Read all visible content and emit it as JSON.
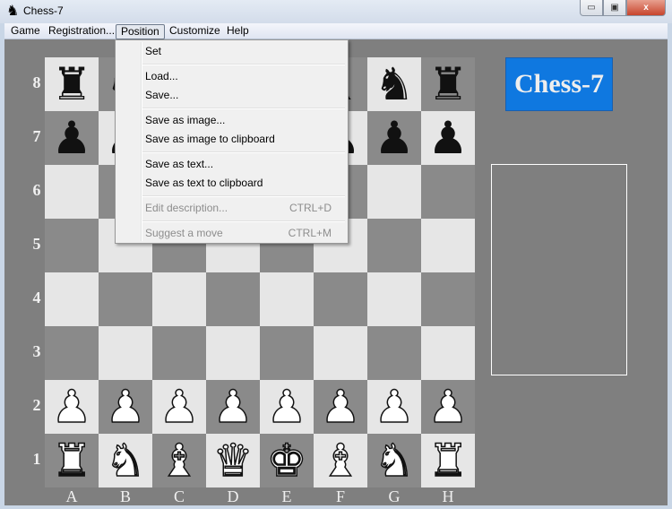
{
  "window": {
    "title": "Chess-7",
    "icon": "♞",
    "minimize": "▭",
    "maximize": "▣",
    "close": "x"
  },
  "menu": [
    "Game",
    "Registration...",
    "Position",
    "Customize",
    "Help"
  ],
  "position_menu": {
    "items": [
      {
        "label": "Set",
        "shortcut": "",
        "enabled": true
      },
      {
        "label": "Load...",
        "shortcut": "",
        "enabled": true
      },
      {
        "label": "Save...",
        "shortcut": "",
        "enabled": true
      },
      {
        "label": "Save as image...",
        "shortcut": "",
        "enabled": true
      },
      {
        "label": "Save as image to clipboard",
        "shortcut": "",
        "enabled": true
      },
      {
        "label": "Save as text...",
        "shortcut": "",
        "enabled": true
      },
      {
        "label": "Save as text to clipboard",
        "shortcut": "",
        "enabled": true
      },
      {
        "label": "Edit description...",
        "shortcut": "CTRL+D",
        "enabled": false
      },
      {
        "label": "Suggest a move",
        "shortcut": "CTRL+M",
        "enabled": false
      }
    ]
  },
  "board": {
    "ranks": [
      "8",
      "7",
      "6",
      "5",
      "4",
      "3",
      "2",
      "1"
    ],
    "files": [
      "A",
      "B",
      "C",
      "D",
      "E",
      "F",
      "G",
      "H"
    ],
    "position": [
      "rnbqkbnr",
      "pppppppp",
      "........",
      "........",
      "........",
      "........",
      "PPPPPPPP",
      "RNBQKBNR"
    ]
  },
  "logo": "Chess-7",
  "colors": {
    "logo_bg": "#0f78e0",
    "light_square": "#e6e6e6",
    "dark_square": "#8a8a8a",
    "background": "#7f7f7f"
  }
}
